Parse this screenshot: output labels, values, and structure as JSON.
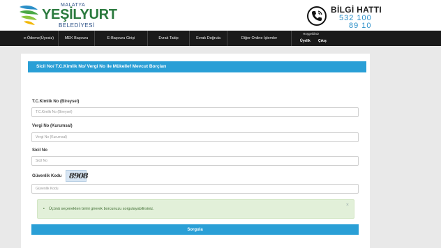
{
  "logo": {
    "small": "MALATYA",
    "main": "YEŞİLYURT",
    "sub": "BELEDİYESİ"
  },
  "hotline": {
    "title": "BİLGİ HATTI",
    "number_line1": "532 100",
    "number_line2": "89 10",
    "icon": "phone-icon"
  },
  "nav": {
    "items": [
      "e-Ödeme(Üyesiz)",
      "MEK Başvuru",
      "E-Başvuru Girişi",
      "Evrak Takip",
      "Evrak Doğrula",
      "Diğer Online İşlemler"
    ],
    "welcome": "Hoşgeldiniz",
    "signup": "Üyelik",
    "logout": "Çıkış"
  },
  "form": {
    "title": "Sicil No/ T.C.Kimlik No/ Vergi No ile Mükellef Mevcut Borçları",
    "tc_label": "T.C.Kimlik No (Bireysel)",
    "tc_placeholder": "T.C.Kimlik No (Bireysel)",
    "vergi_label": "Vergi No (Kurumsal)",
    "vergi_placeholder": "Vergi No (Kurumsal)",
    "sicil_label": "Sicil No",
    "sicil_placeholder": "Sicil No",
    "captcha_label": "Güvenlik Kodu",
    "captcha_code": "8908",
    "captcha_placeholder": "Güvenlik Kodu",
    "alert_text": "Üçünü seçenekten birini girerek borcunuzu sorgulayabilirsiniz.",
    "alert_close": "×",
    "submit_label": "Sorgula"
  },
  "colors": {
    "accent": "#2a9fd6",
    "brand_green": "#2b7a3e",
    "nav_bg": "#1a1a1a",
    "alert_bg": "#e2f0d9"
  }
}
